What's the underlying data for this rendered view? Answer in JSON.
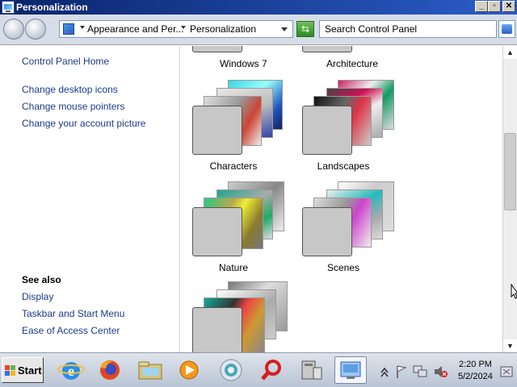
{
  "window": {
    "title": "Personalization",
    "controls": {
      "minimize": "_",
      "maximize": "▫",
      "close": "✕"
    }
  },
  "address": {
    "crumbs": [
      "Appearance and Per...",
      "Personalization"
    ],
    "search_placeholder": "Search Control Panel"
  },
  "sidebar": {
    "home": "Control Panel Home",
    "links": [
      "Change desktop icons",
      "Change mouse pointers",
      "Change your account picture"
    ],
    "see_also_heading": "See also",
    "see_also": [
      "Display",
      "Taskbar and Start Menu",
      "Ease of Access Center"
    ]
  },
  "themes": {
    "partial_top": [
      "Windows 7",
      "Architecture"
    ],
    "items": [
      "Characters",
      "Landscapes",
      "Nature",
      "Scenes"
    ]
  },
  "taskbar": {
    "start_label": "Start",
    "time": "2:20 PM",
    "date": "5/2/2024"
  },
  "colors": {
    "titlebar": "#0a246a",
    "link": "#1c3a8a"
  }
}
